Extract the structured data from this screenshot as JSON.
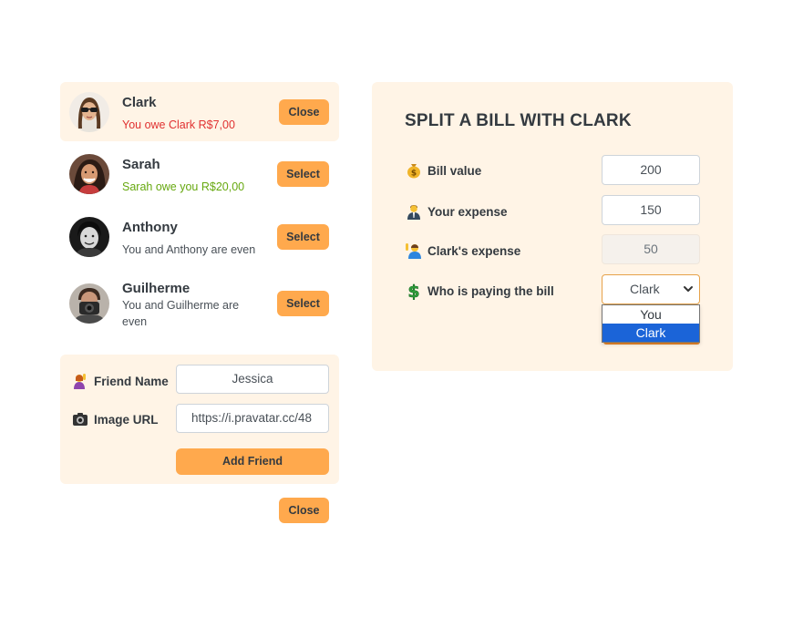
{
  "friends": [
    {
      "name": "Clark",
      "status": "You owe Clark R$7,00",
      "status_tone": "negative",
      "action": "Close",
      "selected": true
    },
    {
      "name": "Sarah",
      "status": "Sarah owe you R$20,00",
      "status_tone": "positive",
      "action": "Select",
      "selected": false
    },
    {
      "name": "Anthony",
      "status": "You and Anthony are even",
      "status_tone": "neutral",
      "action": "Select",
      "selected": false
    },
    {
      "name": "Guilherme",
      "status": "You and Guilherme are even",
      "status_tone": "neutral",
      "action": "Select",
      "selected": false
    }
  ],
  "add_friend": {
    "name_label": "Friend Name",
    "name_icon": "person-raising-hand-icon",
    "name_value": "Jessica",
    "url_label": "Image URL",
    "url_icon": "camera-icon",
    "url_value": "https://i.pravatar.cc/48",
    "submit_label": "Add Friend"
  },
  "close_form_label": "Close",
  "split": {
    "title": "SPLIT A BILL WITH CLARK",
    "bill_label": "Bill value",
    "bill_icon": "money-bag-icon",
    "bill_value": "200",
    "your_label": "Your expense",
    "your_icon": "man-in-suit-icon",
    "your_value": "150",
    "friend_label": "Clark's expense",
    "friend_icon": "person-raising-hand-icon",
    "friend_value": "50",
    "payer_label": "Who is paying the bill",
    "payer_icon": "dollar-sign-icon",
    "payer_value": "Clark",
    "payer_options": [
      "You",
      "Clark"
    ]
  },
  "colors": {
    "accent": "#ffa94d",
    "panel_bg": "#fff4e6",
    "negative": "#e03131",
    "positive": "#66a80f",
    "dropdown_highlight": "#1b64d8"
  }
}
